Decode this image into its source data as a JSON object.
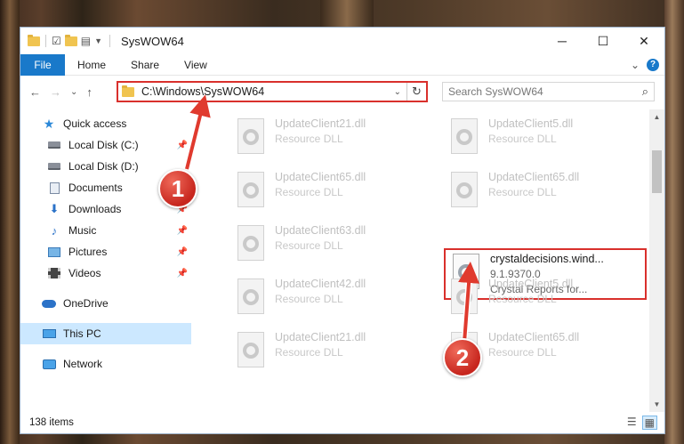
{
  "window": {
    "title": "SysWOW64",
    "minimize": "─",
    "maximize": "☐",
    "close": "✕"
  },
  "ribbon": {
    "tabs": [
      "File",
      "Home",
      "Share",
      "View"
    ],
    "expand": "⌄",
    "help": "?"
  },
  "nav": {
    "back": "←",
    "forward": "→",
    "recent": "⌄",
    "up": "↑"
  },
  "address": {
    "path": "C:\\Windows\\SysWOW64",
    "dropdown": "⌄",
    "refresh": "↻"
  },
  "search": {
    "placeholder": "Search SysWOW64",
    "icon": "⌕"
  },
  "sidebar": {
    "quick_access": "Quick access",
    "items": [
      "Local Disk (C:)",
      "Local Disk (D:)",
      "Documents",
      "Downloads",
      "Music",
      "Pictures",
      "Videos"
    ],
    "onedrive": "OneDrive",
    "this_pc": "This PC",
    "network": "Network"
  },
  "files": [
    {
      "name": "UpdateClient21.dll",
      "type": "Resource DLL"
    },
    {
      "name": "UpdateClient5.dll",
      "type": "Resource DLL"
    },
    {
      "name": "UpdateClient65.dll",
      "type": "Resource DLL"
    },
    {
      "name": "UpdateClient65.dll",
      "type": "Resource DLL"
    },
    {
      "name": "UpdateClient63.dll",
      "type": "Resource DLL"
    },
    {
      "name": "crystaldecisions.wind...",
      "version": "9.1.9370.0",
      "type": "Crystal Reports for..."
    },
    {
      "name": "UpdateClient42.dll",
      "type": "Resource DLL"
    },
    {
      "name": "UpdateClient5.dll",
      "type": "Resource DLL"
    },
    {
      "name": "UpdateClient21.dll",
      "type": "Resource DLL"
    },
    {
      "name": "UpdateClient65.dll",
      "type": "Resource DLL"
    }
  ],
  "status": {
    "item_count": "138 items"
  },
  "annotations": {
    "step1": "1",
    "step2": "2"
  },
  "colors": {
    "accent": "#1979ca",
    "highlight_box": "#d9302c",
    "selection": "#cce8ff"
  }
}
